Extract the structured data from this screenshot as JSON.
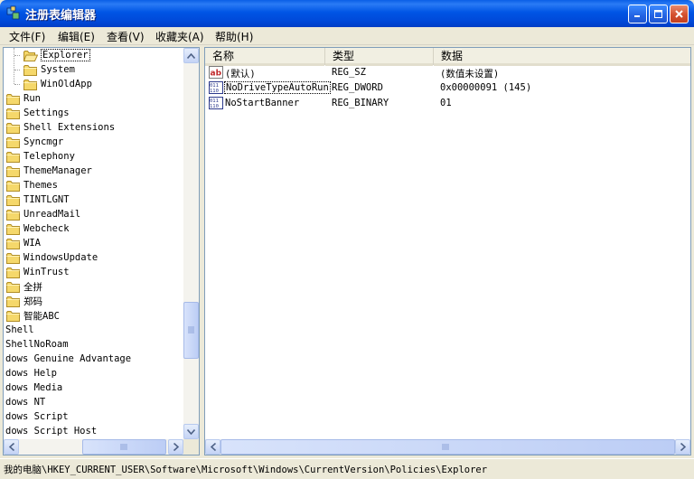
{
  "window": {
    "title": "注册表编辑器",
    "controls": {
      "minimize": "minimize",
      "maximize": "maximize",
      "close": "close"
    }
  },
  "menu": [
    "文件(F)",
    "编辑(E)",
    "查看(V)",
    "收藏夹(A)",
    "帮助(H)"
  ],
  "tree": {
    "items": [
      {
        "label": "Explorer",
        "indent": 2,
        "selected": true,
        "folder": true,
        "open": true
      },
      {
        "label": "System",
        "indent": 2,
        "folder": true
      },
      {
        "label": "WinOldApp",
        "indent": 2,
        "folder": true
      },
      {
        "label": "Run",
        "indent": 1,
        "folder": true
      },
      {
        "label": "Settings",
        "indent": 1,
        "folder": true
      },
      {
        "label": "Shell Extensions",
        "indent": 1,
        "folder": true
      },
      {
        "label": "Syncmgr",
        "indent": 1,
        "folder": true
      },
      {
        "label": "Telephony",
        "indent": 1,
        "folder": true
      },
      {
        "label": "ThemeManager",
        "indent": 1,
        "folder": true
      },
      {
        "label": "Themes",
        "indent": 1,
        "folder": true
      },
      {
        "label": "TINTLGNT",
        "indent": 1,
        "folder": true
      },
      {
        "label": "UnreadMail",
        "indent": 1,
        "folder": true
      },
      {
        "label": "Webcheck",
        "indent": 1,
        "folder": true
      },
      {
        "label": "WIA",
        "indent": 1,
        "folder": true
      },
      {
        "label": "WindowsUpdate",
        "indent": 1,
        "folder": true
      },
      {
        "label": "WinTrust",
        "indent": 1,
        "folder": true
      },
      {
        "label": "全拼",
        "indent": 1,
        "folder": true
      },
      {
        "label": "郑码",
        "indent": 1,
        "folder": true
      },
      {
        "label": "智能ABC",
        "indent": 1,
        "folder": true
      },
      {
        "label": "Shell",
        "indent": 0,
        "folder": false
      },
      {
        "label": "ShellNoRoam",
        "indent": 0,
        "folder": false
      },
      {
        "label": "dows Genuine Advantage",
        "indent": 0,
        "folder": false
      },
      {
        "label": "dows Help",
        "indent": 0,
        "folder": false
      },
      {
        "label": "dows Media",
        "indent": 0,
        "folder": false
      },
      {
        "label": "dows NT",
        "indent": 0,
        "folder": false
      },
      {
        "label": "dows Script",
        "indent": 0,
        "folder": false
      },
      {
        "label": "dows Script Host",
        "indent": 0,
        "folder": false
      }
    ]
  },
  "list": {
    "columns": [
      "名称",
      "类型",
      "数据"
    ],
    "rows": [
      {
        "name": "(默认)",
        "type": "REG_SZ",
        "data": "(数值未设置)",
        "icon": "string-value-icon"
      },
      {
        "name": "NoDriveTypeAutoRun",
        "type": "REG_DWORD",
        "data": "0x00000091 (145)",
        "icon": "binary-value-icon"
      },
      {
        "name": "NoStartBanner",
        "type": "REG_BINARY",
        "data": "01",
        "icon": "binary-value-icon"
      }
    ]
  },
  "status": {
    "path": "我的电脑\\HKEY_CURRENT_USER\\Software\\Microsoft\\Windows\\CurrentVersion\\Policies\\Explorer"
  },
  "colors": {
    "titlebar": "#0055E5",
    "folder": "#F5D86B",
    "selection_border": "#000000"
  }
}
